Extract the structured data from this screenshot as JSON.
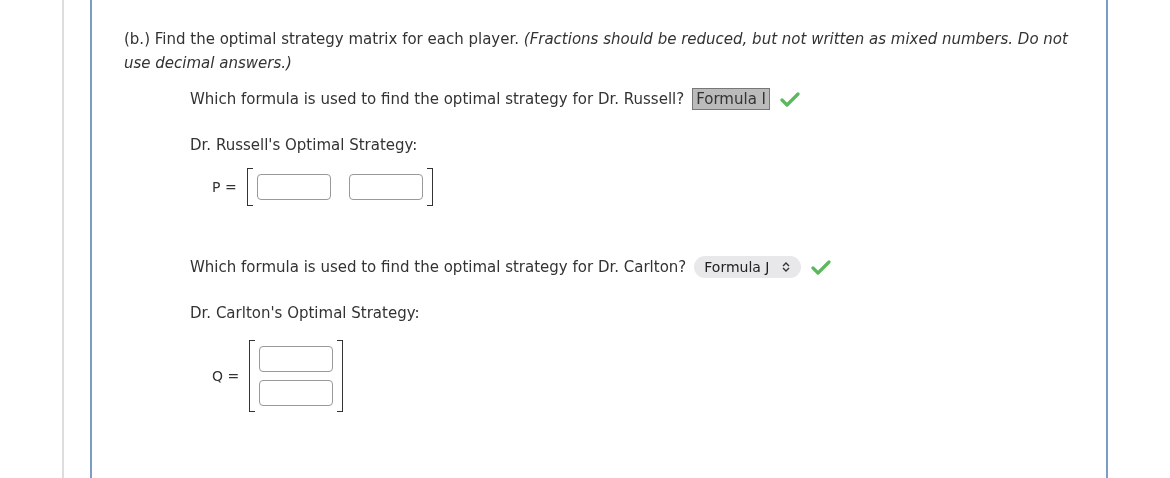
{
  "instructions": "(b.) Find the optimal strategy matrix for each player. *(Fractions should be reduced, but not written as mixed numbers. Do not use decimal answers.)*",
  "parts": [
    {
      "question": "Which formula is used to find the optimal strategy for Dr. Russell?",
      "answer": {
        "kind": "static",
        "value": "Formula I",
        "correct": true
      },
      "strategy_label": "Dr. Russell's Optimal Strategy:",
      "matrix": {
        "name": "P =",
        "kind": "row"
      }
    },
    {
      "question": "Which formula is used to find the optimal strategy for Dr. Carlton?",
      "answer": {
        "kind": "select",
        "value": "Formula J",
        "correct": true
      },
      "strategy_label": "Dr. Carlton's Optimal Strategy:",
      "matrix": {
        "name": "Q =",
        "kind": "column"
      }
    }
  ]
}
